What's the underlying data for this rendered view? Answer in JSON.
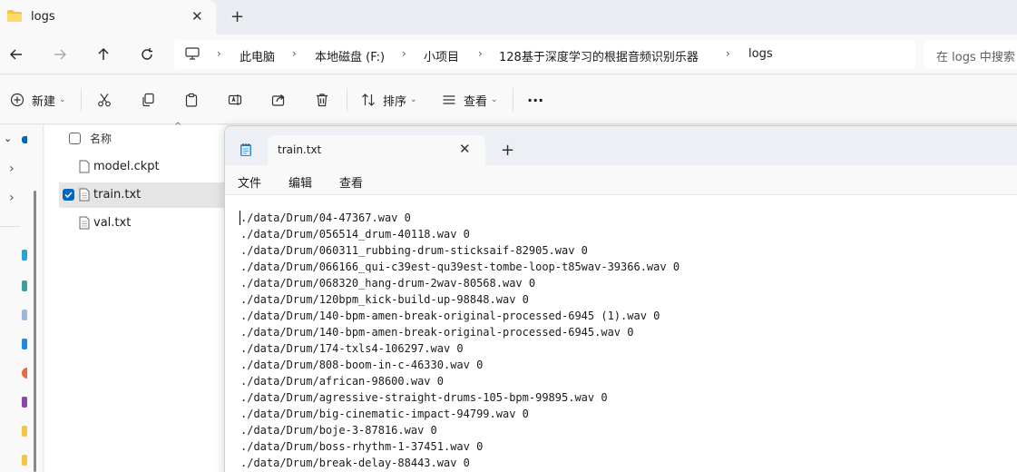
{
  "explorer": {
    "tab": {
      "title": "logs"
    },
    "breadcrumb": [
      "此电脑",
      "本地磁盘 (F:)",
      "小项目",
      "128基于深度学习的根据音频识别乐器",
      "logs"
    ],
    "search_placeholder": "在 logs 中搜索",
    "commands": {
      "new_label": "新建",
      "sort_label": "排序",
      "view_label": "查看",
      "more": "···"
    },
    "column_name": "名称",
    "files": [
      {
        "name": "model.ckpt",
        "selected": false
      },
      {
        "name": "train.txt",
        "selected": true
      },
      {
        "name": "val.txt",
        "selected": false
      }
    ]
  },
  "notepad": {
    "tab_title": "train.txt",
    "menu": [
      "文件",
      "编辑",
      "查看"
    ],
    "lines": [
      "./data/Drum/04-47367.wav 0",
      "./data/Drum/056514_drum-40118.wav 0",
      "./data/Drum/060311_rubbing-drum-sticksaif-82905.wav 0",
      "./data/Drum/066166_qui-c39est-qu39est-tombe-loop-t85wav-39366.wav 0",
      "./data/Drum/068320_hang-drum-2wav-80568.wav 0",
      "./data/Drum/120bpm_kick-build-up-98848.wav 0",
      "./data/Drum/140-bpm-amen-break-original-processed-6945 (1).wav 0",
      "./data/Drum/140-bpm-amen-break-original-processed-6945.wav 0",
      "./data/Drum/174-txls4-106297.wav 0",
      "./data/Drum/808-boom-in-c-46330.wav 0",
      "./data/Drum/african-98600.wav 0",
      "./data/Drum/agressive-straight-drums-105-bpm-99895.wav 0",
      "./data/Drum/big-cinematic-impact-94799.wav 0",
      "./data/Drum/boje-3-87816.wav 0",
      "./data/Drum/boss-rhythm-1-37451.wav 0",
      "./data/Drum/break-delay-88443.wav 0"
    ]
  },
  "colors": {
    "accent": "#0067c0",
    "folder": "#f4c443"
  }
}
